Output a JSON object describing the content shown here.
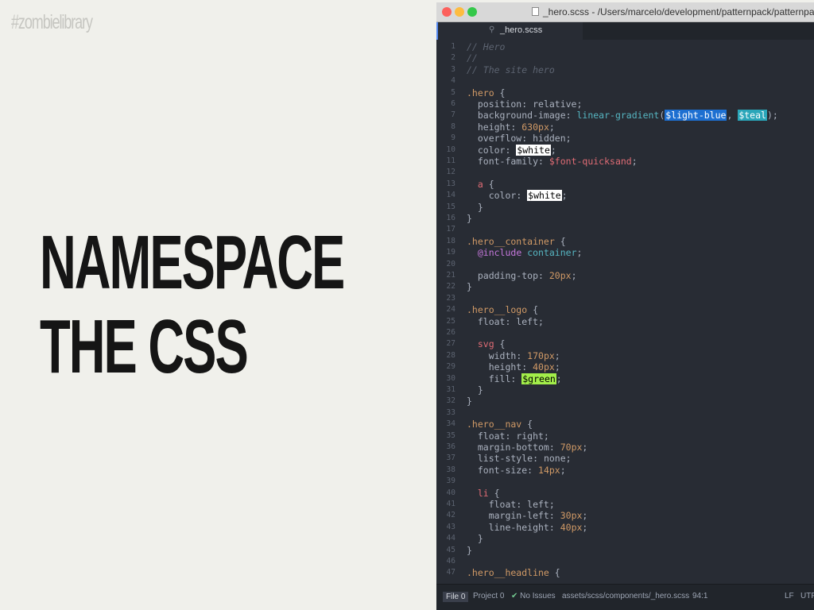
{
  "slide": {
    "hashtag": "#zombielibrary",
    "headline_line1": "NAMESPACE",
    "headline_line2": "THE CSS"
  },
  "window": {
    "title": "_hero.scss - /Users/marcelo/development/patternpack/patternpack.githu",
    "tab_label": "_hero.scss",
    "tab_icon": "file-icon"
  },
  "statusbar": {
    "file_tab": "File",
    "file_count": "0",
    "project_tab": "Project",
    "project_count": "0",
    "issues": "No Issues",
    "path": "assets/scss/components/_hero.scss",
    "cursor": "94:1",
    "line_ending": "LF",
    "encoding": "UTF"
  },
  "code_lines": [
    [
      [
        "// Hero",
        "comment"
      ]
    ],
    [
      [
        "//",
        "comment"
      ]
    ],
    [
      [
        "// The site hero",
        "comment"
      ]
    ],
    [],
    [
      [
        ".hero",
        "selector"
      ],
      [
        " {",
        "punct"
      ]
    ],
    [
      [
        "  position",
        "prop"
      ],
      [
        ": relative;",
        "value"
      ]
    ],
    [
      [
        "  background-image",
        "prop"
      ],
      [
        ": ",
        "value"
      ],
      [
        "linear-gradient",
        "func"
      ],
      [
        "(",
        "punct"
      ],
      [
        "$light-blue",
        "hl-blue"
      ],
      [
        ", ",
        "punct"
      ],
      [
        "$teal",
        "hl-teal"
      ],
      [
        ");",
        "punct"
      ]
    ],
    [
      [
        "  height",
        "prop"
      ],
      [
        ": ",
        "value"
      ],
      [
        "630px",
        "num"
      ],
      [
        ";",
        "punct"
      ]
    ],
    [
      [
        "  overflow",
        "prop"
      ],
      [
        ": hidden;",
        "value"
      ]
    ],
    [
      [
        "  color",
        "prop"
      ],
      [
        ": ",
        "value"
      ],
      [
        "$white",
        "hl-white"
      ],
      [
        ";",
        "punct"
      ]
    ],
    [
      [
        "  font-family",
        "prop"
      ],
      [
        ": ",
        "value"
      ],
      [
        "$font-quicksand",
        "var"
      ],
      [
        ";",
        "punct"
      ]
    ],
    [],
    [
      [
        "  a",
        "tag"
      ],
      [
        " {",
        "punct"
      ]
    ],
    [
      [
        "    color",
        "prop"
      ],
      [
        ": ",
        "value"
      ],
      [
        "$white",
        "hl-white"
      ],
      [
        ";",
        "punct"
      ]
    ],
    [
      [
        "  }",
        "punct"
      ]
    ],
    [
      [
        "}",
        "punct"
      ]
    ],
    [],
    [
      [
        ".hero__container",
        "selector"
      ],
      [
        " {",
        "punct"
      ]
    ],
    [
      [
        "  ",
        "punct"
      ],
      [
        "@include",
        "at"
      ],
      [
        " ",
        "punct"
      ],
      [
        "container",
        "func"
      ],
      [
        ";",
        "punct"
      ]
    ],
    [],
    [
      [
        "  padding-top",
        "prop"
      ],
      [
        ": ",
        "value"
      ],
      [
        "20px",
        "num"
      ],
      [
        ";",
        "punct"
      ]
    ],
    [
      [
        "}",
        "punct"
      ]
    ],
    [],
    [
      [
        ".hero__logo",
        "selector"
      ],
      [
        " {",
        "punct"
      ]
    ],
    [
      [
        "  float",
        "prop"
      ],
      [
        ": left;",
        "value"
      ]
    ],
    [],
    [
      [
        "  svg",
        "tag"
      ],
      [
        " {",
        "punct"
      ]
    ],
    [
      [
        "    width",
        "prop"
      ],
      [
        ": ",
        "value"
      ],
      [
        "170px",
        "num"
      ],
      [
        ";",
        "punct"
      ]
    ],
    [
      [
        "    height",
        "prop"
      ],
      [
        ": ",
        "value"
      ],
      [
        "40px",
        "num"
      ],
      [
        ";",
        "punct"
      ]
    ],
    [
      [
        "    fill",
        "prop"
      ],
      [
        ": ",
        "value"
      ],
      [
        "$green",
        "hl-green"
      ],
      [
        ";",
        "punct"
      ]
    ],
    [
      [
        "  }",
        "punct"
      ]
    ],
    [
      [
        "}",
        "punct"
      ]
    ],
    [],
    [
      [
        ".hero__nav",
        "selector"
      ],
      [
        " {",
        "punct"
      ]
    ],
    [
      [
        "  float",
        "prop"
      ],
      [
        ": right;",
        "value"
      ]
    ],
    [
      [
        "  margin-bottom",
        "prop"
      ],
      [
        ": ",
        "value"
      ],
      [
        "70px",
        "num"
      ],
      [
        ";",
        "punct"
      ]
    ],
    [
      [
        "  list-style",
        "prop"
      ],
      [
        ": none;",
        "value"
      ]
    ],
    [
      [
        "  font-size",
        "prop"
      ],
      [
        ": ",
        "value"
      ],
      [
        "14px",
        "num"
      ],
      [
        ";",
        "punct"
      ]
    ],
    [],
    [
      [
        "  li",
        "tag"
      ],
      [
        " {",
        "punct"
      ]
    ],
    [
      [
        "    float",
        "prop"
      ],
      [
        ": left;",
        "value"
      ]
    ],
    [
      [
        "    margin-left",
        "prop"
      ],
      [
        ": ",
        "value"
      ],
      [
        "30px",
        "num"
      ],
      [
        ";",
        "punct"
      ]
    ],
    [
      [
        "    line-height",
        "prop"
      ],
      [
        ": ",
        "value"
      ],
      [
        "40px",
        "num"
      ],
      [
        ";",
        "punct"
      ]
    ],
    [
      [
        "  }",
        "punct"
      ]
    ],
    [
      [
        "}",
        "punct"
      ]
    ],
    [],
    [
      [
        ".hero__headline",
        "selector"
      ],
      [
        " {",
        "punct"
      ]
    ]
  ]
}
